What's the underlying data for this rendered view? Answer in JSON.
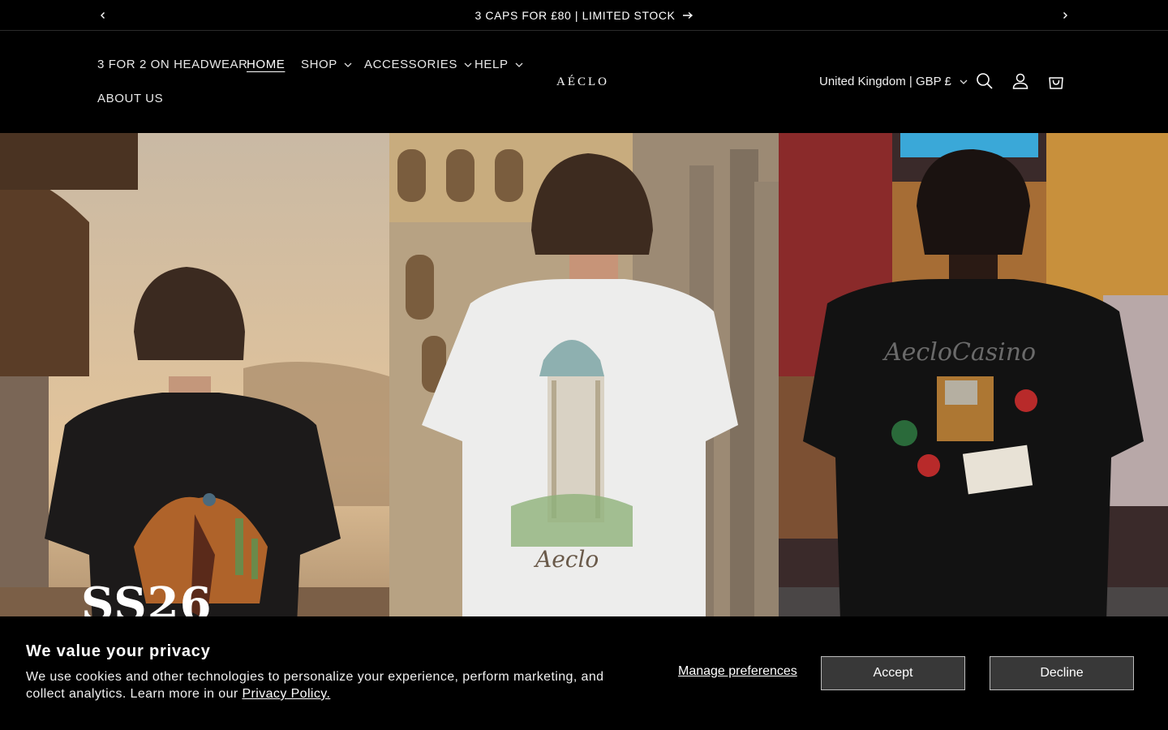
{
  "announcement": {
    "text": "3 CAPS FOR £80 | LIMITED STOCK"
  },
  "header": {
    "logo": "AÉCLO",
    "nav": [
      {
        "label": "3 FOR 2 ON HEADWEAR",
        "active": false,
        "dropdown": false
      },
      {
        "label": "HOME",
        "active": true,
        "dropdown": false
      },
      {
        "label": "SHOP",
        "active": false,
        "dropdown": true
      },
      {
        "label": "ACCESSORIES",
        "active": false,
        "dropdown": true
      },
      {
        "label": "HELP",
        "active": false,
        "dropdown": true
      },
      {
        "label": "ABOUT US",
        "active": false,
        "dropdown": false
      }
    ],
    "country_selector": "United Kingdom | GBP £",
    "icons": [
      "search-icon",
      "account-icon",
      "cart-icon"
    ]
  },
  "hero": {
    "heading": "SS26"
  },
  "cookie_banner": {
    "title": "We value your privacy",
    "body": "We use cookies and other technologies to personalize your experience, perform marketing, and collect analytics. Learn more in our ",
    "policy_link": "Privacy Policy.",
    "manage_label": "Manage preferences",
    "accept_label": "Accept",
    "decline_label": "Decline"
  },
  "colors": {
    "background": "#000000",
    "text": "#ffffff",
    "button_bg": "#383838"
  }
}
